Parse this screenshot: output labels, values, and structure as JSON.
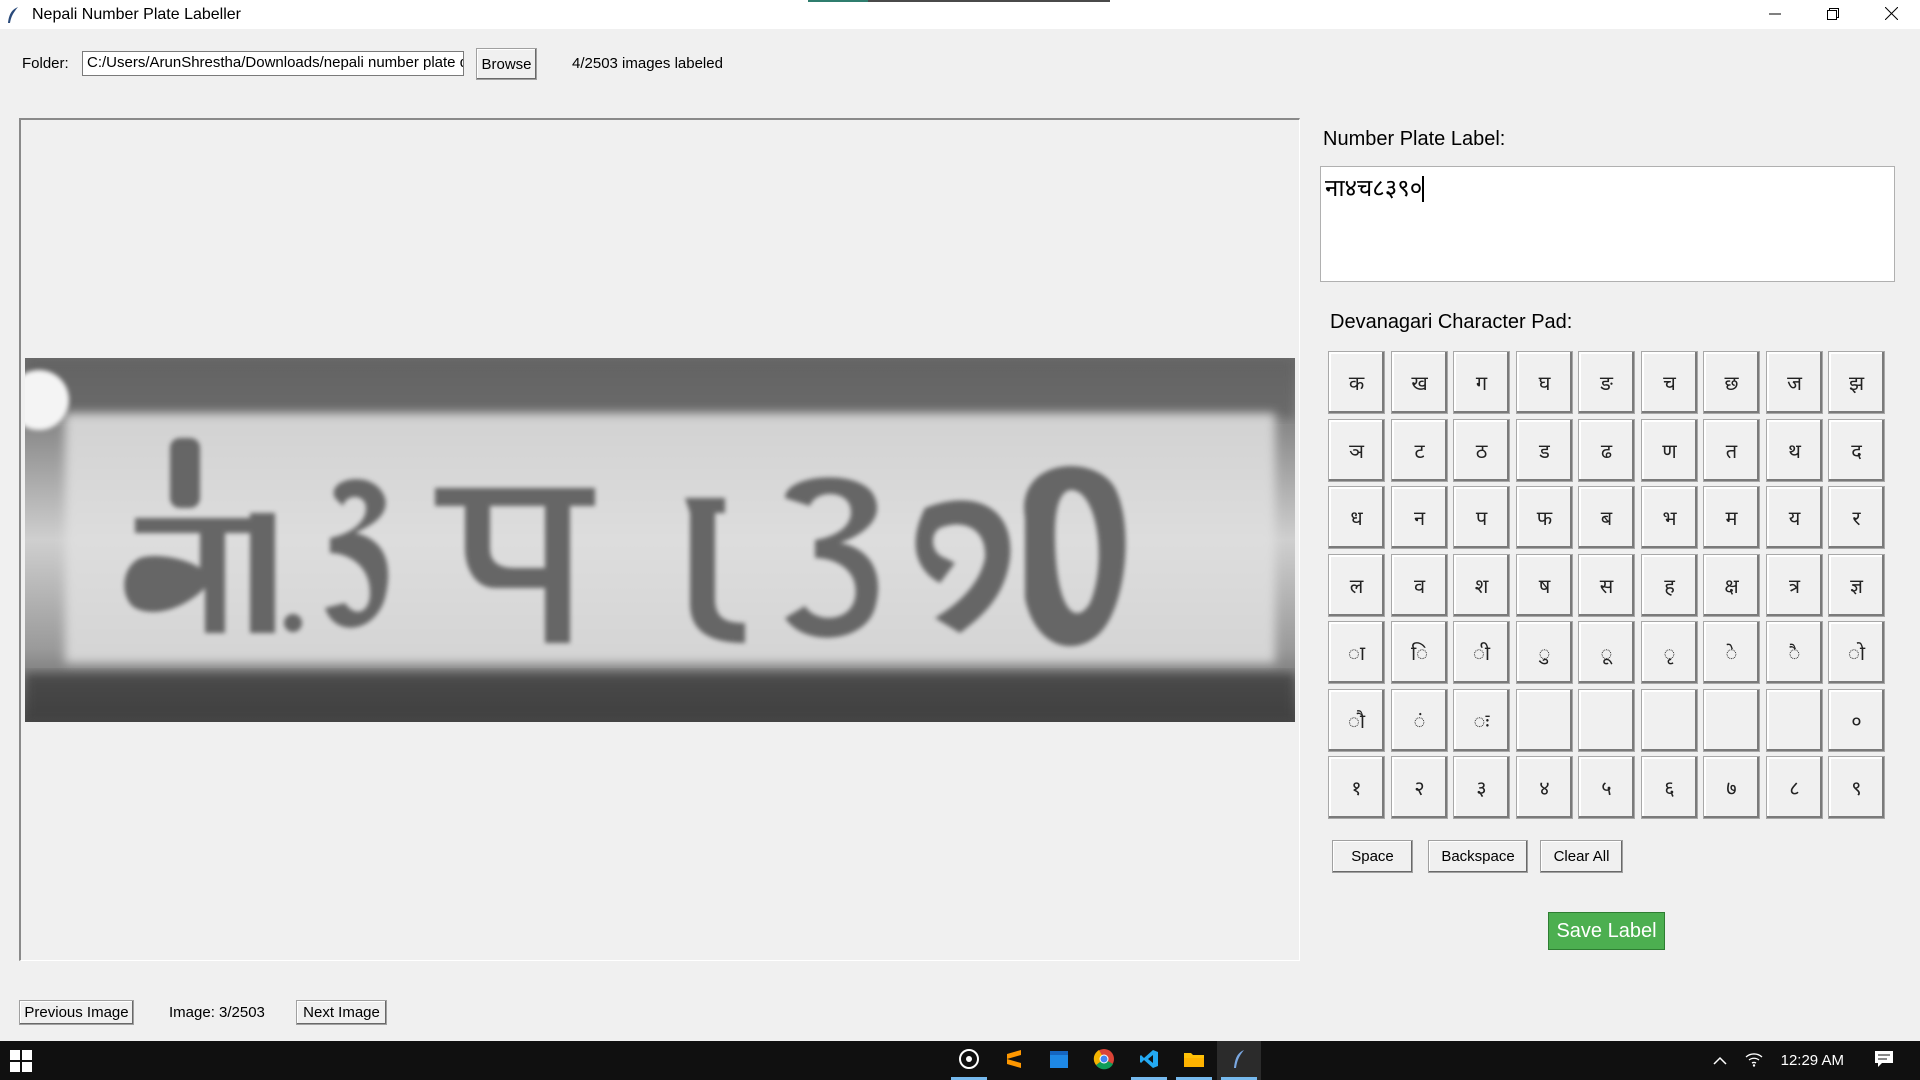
{
  "window": {
    "title": "Nepali Number Plate Labeller"
  },
  "toolbar": {
    "folder_label": "Folder:",
    "folder_value": "C:/Users/ArunShrestha/Downloads/nepali number plate d",
    "browse_label": "Browse",
    "labeled_status": "4/2503 images labeled"
  },
  "label_panel": {
    "heading": "Number Plate Label:",
    "value": "ना४च८३९०"
  },
  "pad": {
    "heading": "Devanagari Character Pad:",
    "rows": [
      [
        "क",
        "ख",
        "ग",
        "घ",
        "ङ",
        "च",
        "छ",
        "ज",
        "झ"
      ],
      [
        "ञ",
        "ट",
        "ठ",
        "ड",
        "ढ",
        "ण",
        "त",
        "थ",
        "द"
      ],
      [
        "ध",
        "न",
        "प",
        "फ",
        "ब",
        "भ",
        "म",
        "य",
        "र"
      ],
      [
        "ल",
        "व",
        "श",
        "ष",
        "स",
        "ह",
        "क्ष",
        "त्र",
        "ज्ञ"
      ],
      [
        "ा",
        "ि",
        "ी",
        "ु",
        "ू",
        "ृ",
        "े",
        "ै",
        "ो"
      ],
      [
        "ौ",
        "ं",
        "ः",
        "",
        "",
        "",
        "",
        "",
        "०"
      ],
      [
        "१",
        "२",
        "३",
        "४",
        "५",
        "६",
        "७",
        "८",
        "९"
      ]
    ],
    "space_label": "Space",
    "backspace_label": "Backspace",
    "clear_label": "Clear All",
    "save_label": "Save Label"
  },
  "navigation": {
    "prev_label": "Previous Image",
    "counter": "Image: 3/2503",
    "next_label": "Next Image"
  },
  "taskbar": {
    "clock": "12:29 AM",
    "apps": [
      "obs-icon",
      "sublime-icon",
      "calendar-icon",
      "chrome-icon",
      "vscode-icon",
      "file-explorer-icon",
      "python-feather-icon"
    ]
  },
  "colors": {
    "save_button": "#4caf50",
    "taskbar": "#101010"
  }
}
